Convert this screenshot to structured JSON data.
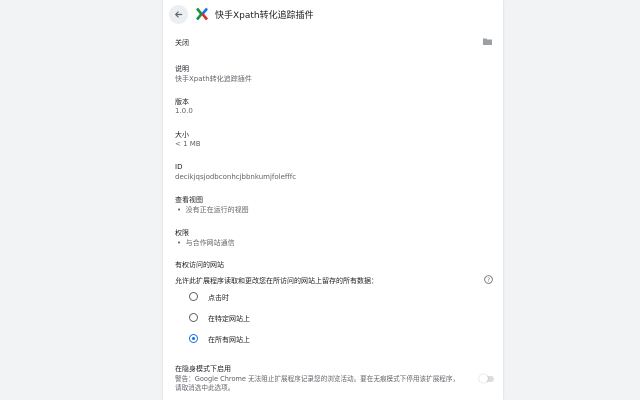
{
  "header": {
    "title": "快手Xpath转化追踪插件"
  },
  "icons": {
    "back": "arrow-left-icon",
    "extension": "xpath-extension-logo-icon",
    "folder": "folder-icon",
    "help": "help-circle-icon"
  },
  "colors": {
    "accent": "#1a73e8",
    "logo_green": "#1e8e3e",
    "logo_red": "#d93025",
    "logo_blue": "#1a73e8"
  },
  "sections": {
    "close_label": "关闭",
    "description_label": "说明",
    "description_value": "快手Xpath转化追踪插件",
    "version_label": "版本",
    "version_value": "1.0.0",
    "size_label": "大小",
    "size_value": "< 1 MB",
    "id_label": "ID",
    "id_value": "decikjqsjodbconhcjbbnkumjfolefffc",
    "views_label": "查看视图",
    "views_item": "没有正在运行的视图",
    "permissions_label": "权限",
    "permissions_item": "与合作网站通信"
  },
  "site_access": {
    "heading": "有权访问的网站",
    "description": "允许此扩展程序读取和更改您在所访问的网站上留存的所有数据：",
    "options": [
      {
        "label": "点击时",
        "checked": false
      },
      {
        "label": "在特定网站上",
        "checked": false
      },
      {
        "label": "在所有网站上",
        "checked": true
      }
    ]
  },
  "incognito": {
    "label": "在隐身模式下启用",
    "warning": "警告：Google Chrome 无法阻止扩展程序记录您的浏览活动。要在无痕模式下停用该扩展程序，请取消选中此选项。",
    "enabled": false
  }
}
